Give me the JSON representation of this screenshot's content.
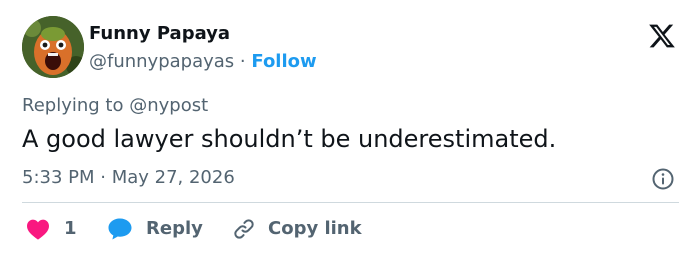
{
  "author": {
    "name": "Funny Papaya",
    "handle": "@funnypapayas",
    "separator": "·",
    "follow_label": "Follow"
  },
  "icons": {
    "brand": "x-logo-icon",
    "info": "info-icon",
    "like": "heart-icon",
    "reply": "speech-bubble-icon",
    "copy": "link-icon"
  },
  "tweet": {
    "reply_prefix": "Replying to ",
    "reply_to": "@nypost",
    "text": "A good lawyer shouldn’t be underestimated.",
    "timestamp": "5:33 PM · May 27, 2026"
  },
  "actions": {
    "like_count": "1",
    "reply_label": "Reply",
    "copy_label": "Copy link"
  },
  "colors": {
    "accent": "#1d9bf0",
    "like": "#f91880",
    "muted": "#536471",
    "text": "#0f1419"
  }
}
